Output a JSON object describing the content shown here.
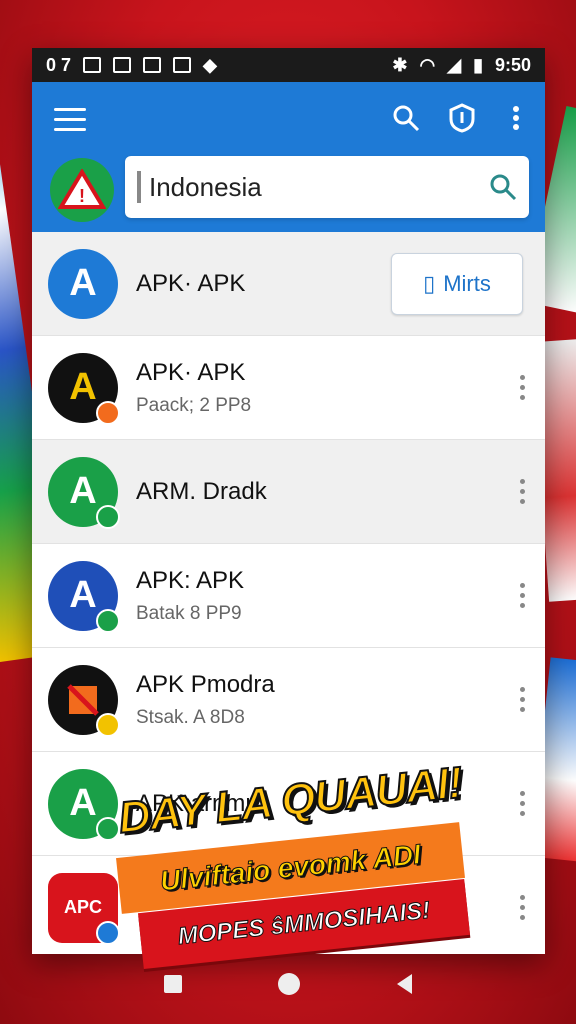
{
  "status_bar": {
    "left_text": "0 7",
    "time": "9:50"
  },
  "search": {
    "value": "Indonesia",
    "placeholder": ""
  },
  "apps": [
    {
      "title": "APK· APK",
      "subtitle": "",
      "action_label": "Mirts",
      "icon_letter": "A",
      "icon_color": "#1e7ad6",
      "badge_color": ""
    },
    {
      "title": "APK· APK",
      "subtitle": "Paack; 2 PP8",
      "icon_letter": "A",
      "icon_color": "#111111",
      "badge_color": "#f26b1d"
    },
    {
      "title": "ARM. Dradk",
      "subtitle": "",
      "icon_letter": "A",
      "icon_color": "#1aa048",
      "badge_color": "#1aa048"
    },
    {
      "title": "APK: APK",
      "subtitle": "Batak 8 PP9",
      "icon_letter": "A",
      "icon_color": "#1f4fb8",
      "badge_color": "#1aa048"
    },
    {
      "title": "APK Pmodra",
      "subtitle": "Stsak. A 8D8",
      "icon_letter": "",
      "icon_color": "#111111",
      "badge_color": "#f2c200"
    },
    {
      "title": "APK arnmr",
      "subtitle": "",
      "icon_letter": "A",
      "icon_color": "#1aa048",
      "badge_color": "#1aa048"
    },
    {
      "title": "",
      "subtitle": "",
      "icon_letter": "APC",
      "icon_color": "#d8141c",
      "badge_color": "#1e7ad6"
    }
  ],
  "promo": {
    "line1": "DAY LA QUAUAI!",
    "line2": "Ulviftaio evomk ADI",
    "line3": "MOPES ŝMMOSIHAIS!"
  },
  "colors": {
    "appbar": "#1e7ad6",
    "accent": "#1e73c9",
    "background": "#d8141c"
  }
}
